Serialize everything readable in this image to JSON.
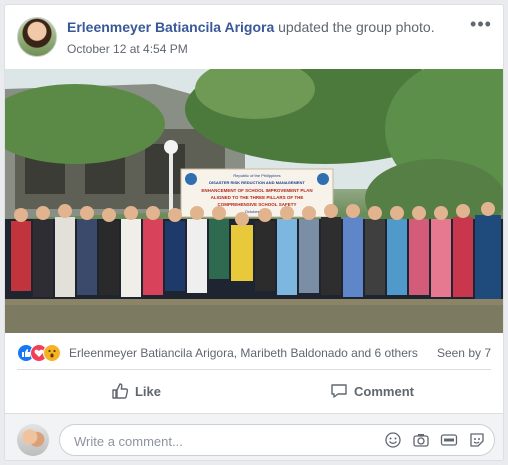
{
  "post": {
    "author": "Erleenmeyer Batiancila Arigora",
    "action": " updated the group photo.",
    "timestamp": "October 12 at 4:54 PM",
    "more_label": "•••"
  },
  "photo": {
    "banner_lines": [
      "Republic of the Philippines",
      "DISASTER RISK REDUCTION AND MANAGEMENT",
      "ENHANCEMENT OF SCHOOL IMPROVEMENT PLAN",
      "ALIGNED TO THE THREE PILLARS OF THE",
      "COMPREHENSIVE SCHOOL SAFETY",
      "October 2019"
    ]
  },
  "reactions": {
    "icons": [
      "like-reaction-icon",
      "love-reaction-icon",
      "wow-reaction-icon"
    ],
    "text": "Erleenmeyer Batiancila Arigora, Maribeth Baldonado and 6 others",
    "seen": "Seen by 7"
  },
  "actions": {
    "like_label": "Like",
    "comment_label": "Comment"
  },
  "composer": {
    "placeholder": "Write a comment...",
    "icons": [
      "emoji-icon",
      "camera-icon",
      "gif-icon",
      "sticker-icon"
    ]
  },
  "colors": {
    "link": "#385898",
    "secondary_text": "#606770",
    "like_blue": "#1877f2",
    "love_red": "#f33e58",
    "wow_yellow": "#f7b125"
  }
}
